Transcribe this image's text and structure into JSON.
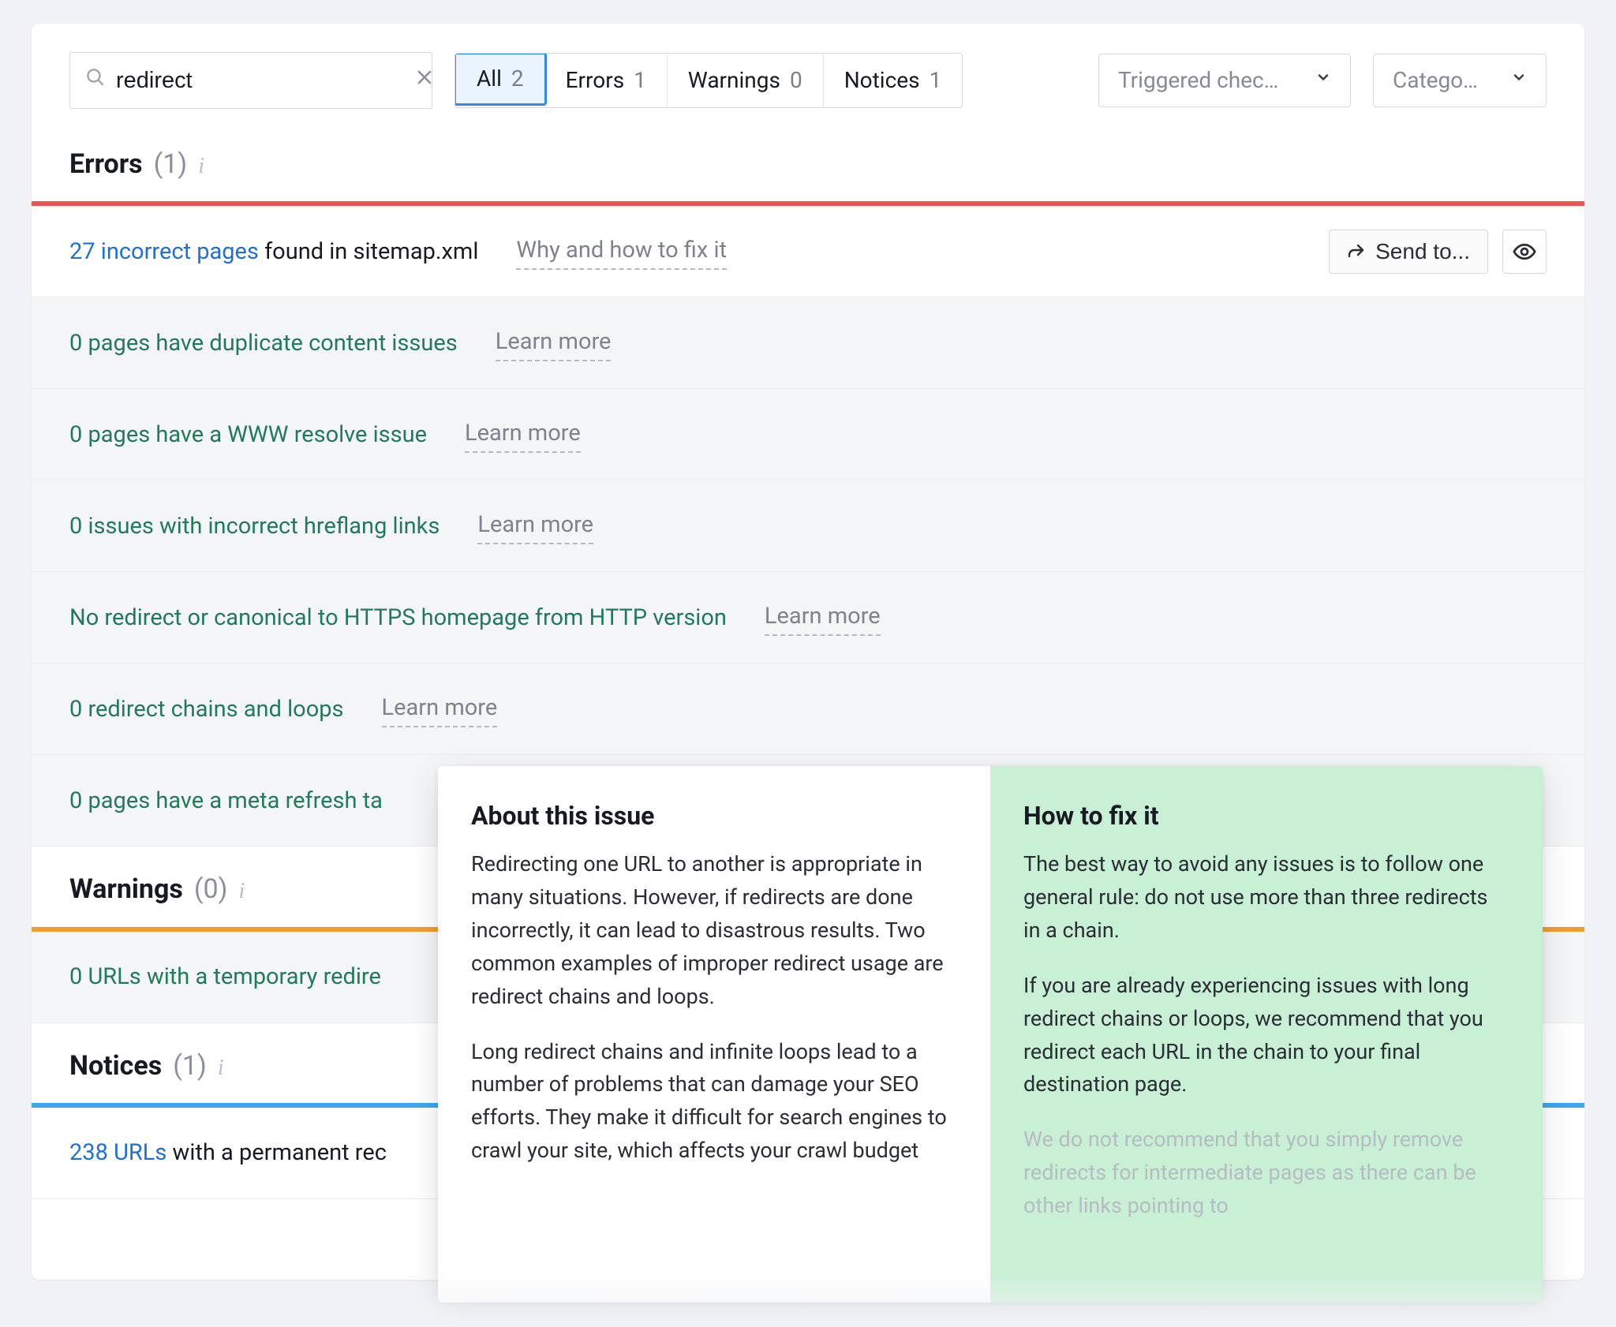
{
  "search": {
    "value": "redirect"
  },
  "filters": [
    {
      "id": "all",
      "label": "All",
      "count": "2",
      "active": true
    },
    {
      "id": "errors",
      "label": "Errors",
      "count": "1",
      "active": false
    },
    {
      "id": "warnings",
      "label": "Warnings",
      "count": "0",
      "active": false
    },
    {
      "id": "notices",
      "label": "Notices",
      "count": "1",
      "active": false
    }
  ],
  "dropdowns": {
    "triggered": "Triggered chec…",
    "category": "Catego…"
  },
  "sections": {
    "errors": {
      "title": "Errors",
      "count": "(1)"
    },
    "warnings": {
      "title": "Warnings",
      "count": "(0)"
    },
    "notices": {
      "title": "Notices",
      "count": "(1)"
    }
  },
  "actions": {
    "why_fix": "Why and how to fix it",
    "learn_more": "Learn more",
    "send_to": "Send to..."
  },
  "errors_rows": [
    {
      "kind": "link",
      "link": "27 incorrect pages",
      "suffix": " found in sitemap.xml",
      "learn": "why_fix",
      "active_row": true
    },
    {
      "kind": "zero",
      "text": "0 pages have duplicate content issues",
      "learn": "learn_more"
    },
    {
      "kind": "zero",
      "text": "0 pages have a WWW resolve issue",
      "learn": "learn_more"
    },
    {
      "kind": "zero",
      "text": "0 issues with incorrect hreflang links",
      "learn": "learn_more"
    },
    {
      "kind": "zero",
      "text": "No redirect or canonical to HTTPS homepage from HTTP version",
      "learn": "learn_more"
    },
    {
      "kind": "zero",
      "text": "0 redirect chains and loops",
      "learn": "learn_more"
    },
    {
      "kind": "zero",
      "text": "0 pages have a meta refresh ta",
      "learn": ""
    }
  ],
  "warnings_rows": [
    {
      "kind": "zero",
      "text": "0 URLs with a temporary redire",
      "learn": ""
    }
  ],
  "notices_rows": [
    {
      "kind": "link",
      "link": "238 URLs",
      "suffix": " with a permanent rec",
      "learn": ""
    }
  ],
  "popover": {
    "left": {
      "title": "About this issue",
      "p1": "Redirecting one URL to another is appropriate in many situations. However, if redirects are done incorrectly, it can lead to disastrous results. Two common examples of improper redirect usage are redirect chains and loops.",
      "p2": "Long redirect chains and infinite loops lead to a number of problems that can damage your SEO efforts. They make it difficult for search engines to crawl your site, which affects your crawl budget"
    },
    "right": {
      "title": "How to fix it",
      "p1": "The best way to avoid any issues is to follow one general rule: do not use more than three redirects in a chain.",
      "p2": "If you are already experiencing issues with long redirect chains or loops, we recommend that you redirect each URL in the chain to your final destination page.",
      "p3": "We do not recommend that you simply remove redirects for intermediate pages as there can be other links pointing to"
    }
  }
}
